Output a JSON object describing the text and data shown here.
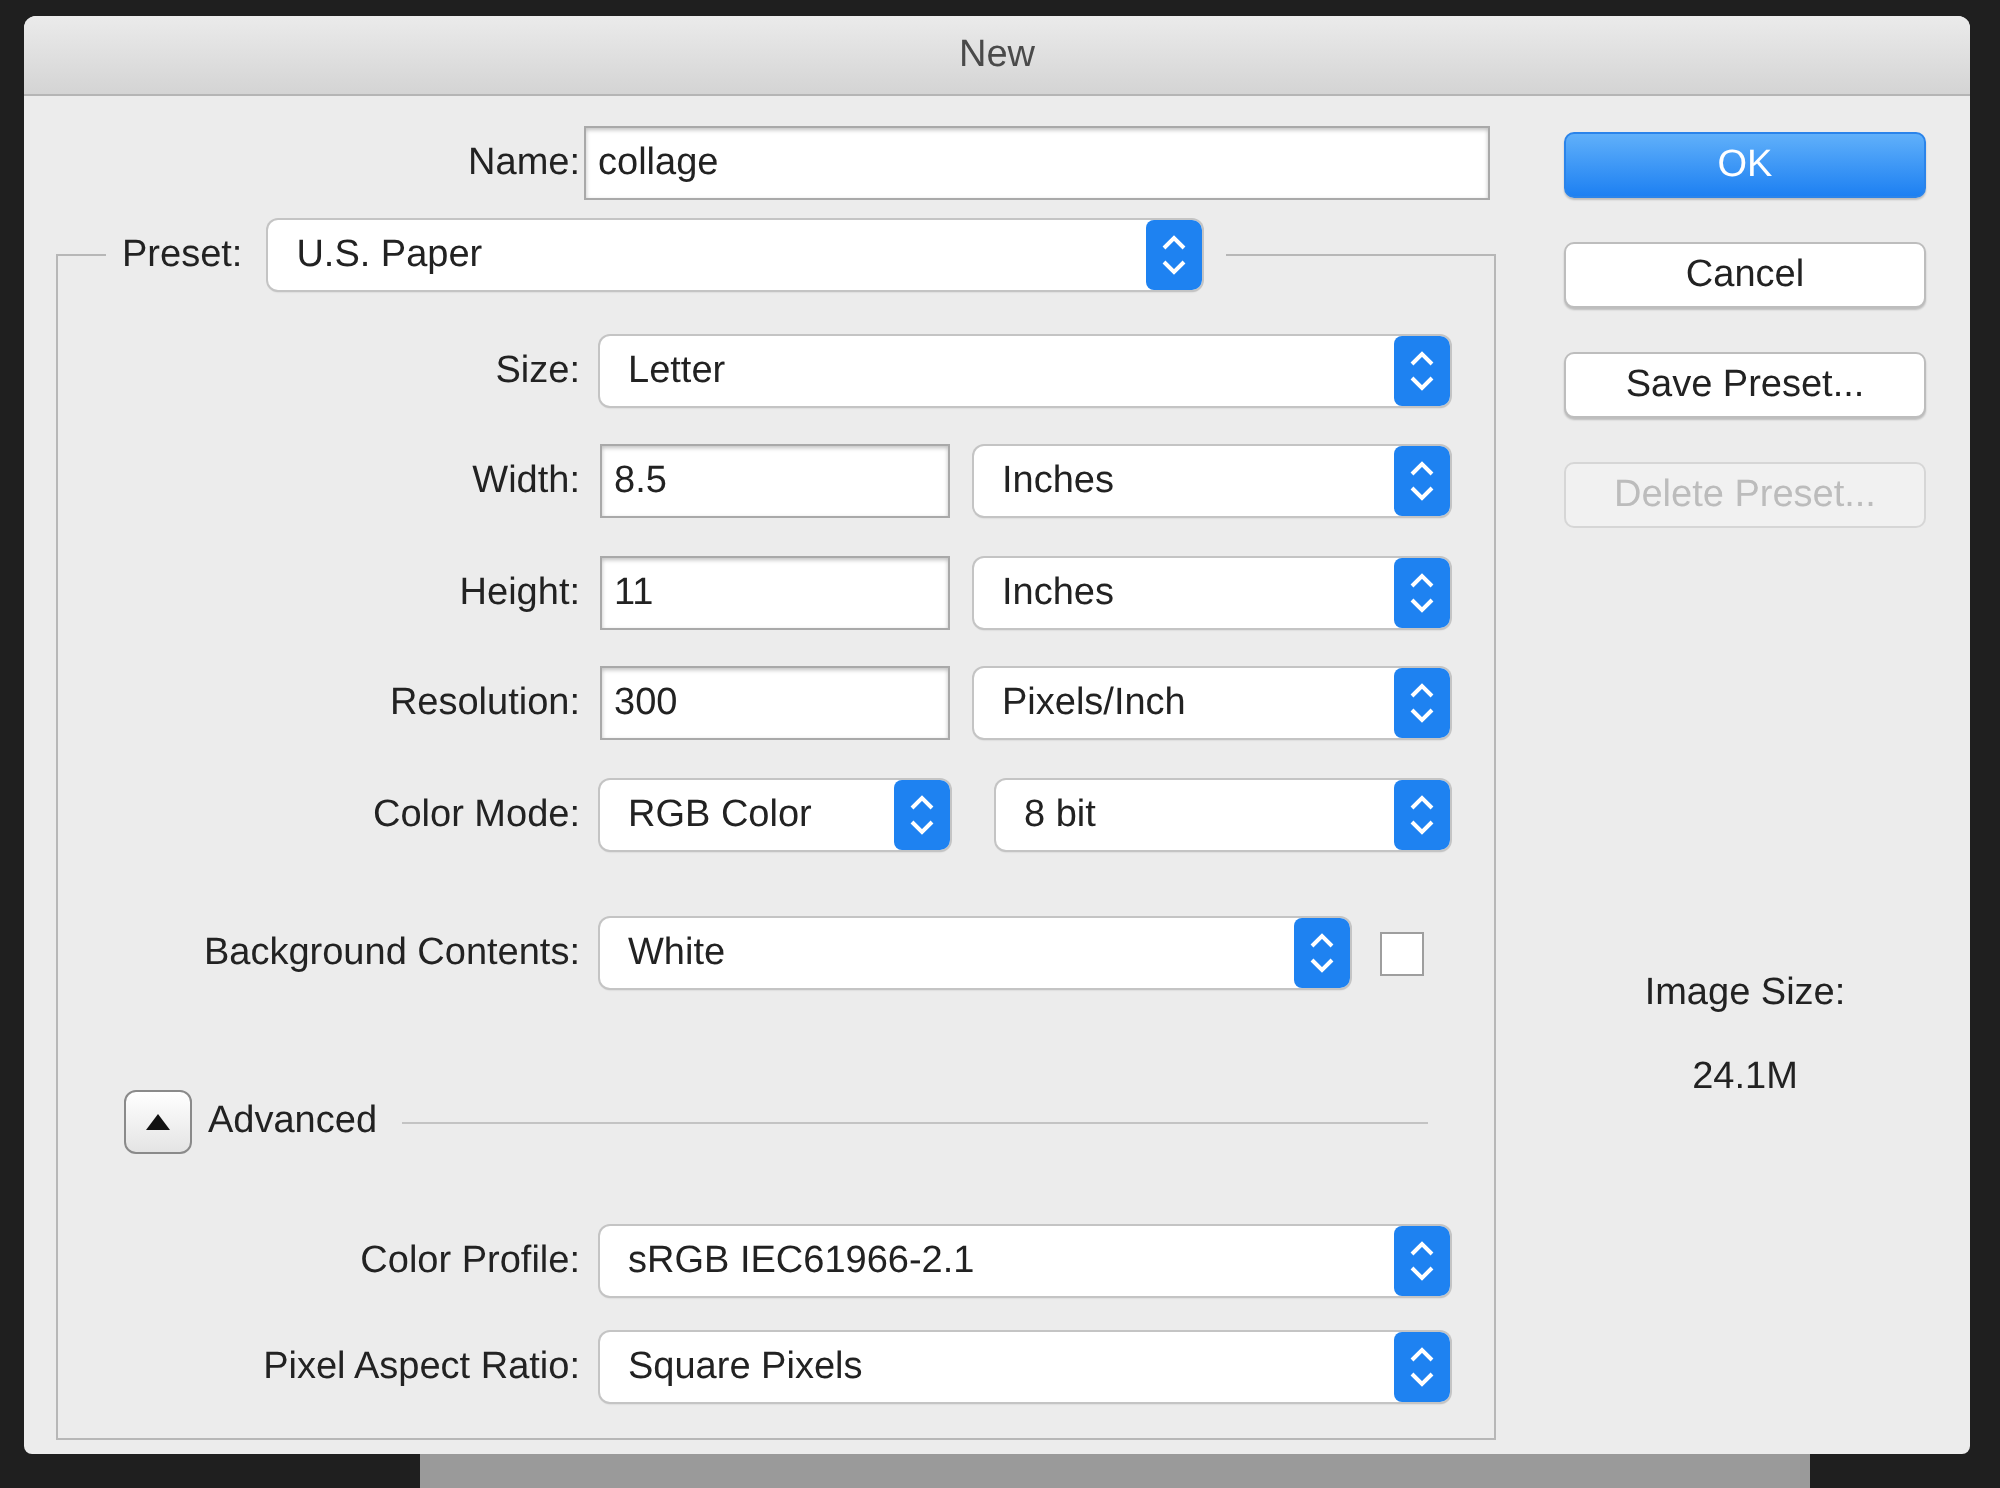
{
  "window": {
    "title": "New"
  },
  "name": {
    "label": "Name:",
    "value": "collage"
  },
  "preset": {
    "label": "Preset:",
    "value": "U.S. Paper"
  },
  "rows": [
    {
      "kind": "select",
      "label": "Size:",
      "value": "Letter"
    },
    {
      "kind": "input_unit",
      "label": "Width:",
      "value": "8.5",
      "unit": "Inches"
    },
    {
      "kind": "input_unit",
      "label": "Height:",
      "value": "11",
      "unit": "Inches"
    },
    {
      "kind": "input_unit",
      "label": "Resolution:",
      "value": "300",
      "unit": "Pixels/Inch"
    },
    {
      "kind": "mode",
      "label": "Color Mode:",
      "value": "RGB Color",
      "depth": "8 bit"
    },
    {
      "kind": "select_check",
      "label": "Background Contents:",
      "value": "White",
      "checked": false
    }
  ],
  "advanced": {
    "label": "Advanced",
    "expanded": true
  },
  "advanced_rows": [
    {
      "label": "Color Profile:",
      "value": "sRGB IEC61966-2.1"
    },
    {
      "label": "Pixel Aspect Ratio:",
      "value": "Square Pixels"
    }
  ],
  "buttons": [
    {
      "label": "OK",
      "default": true,
      "disabled": false
    },
    {
      "label": "Cancel",
      "default": false,
      "disabled": false
    },
    {
      "label": "Save Preset...",
      "default": false,
      "disabled": false
    },
    {
      "label": "Delete Preset...",
      "default": false,
      "disabled": true
    }
  ],
  "image_size": {
    "label": "Image Size:",
    "value": "24.1M"
  }
}
